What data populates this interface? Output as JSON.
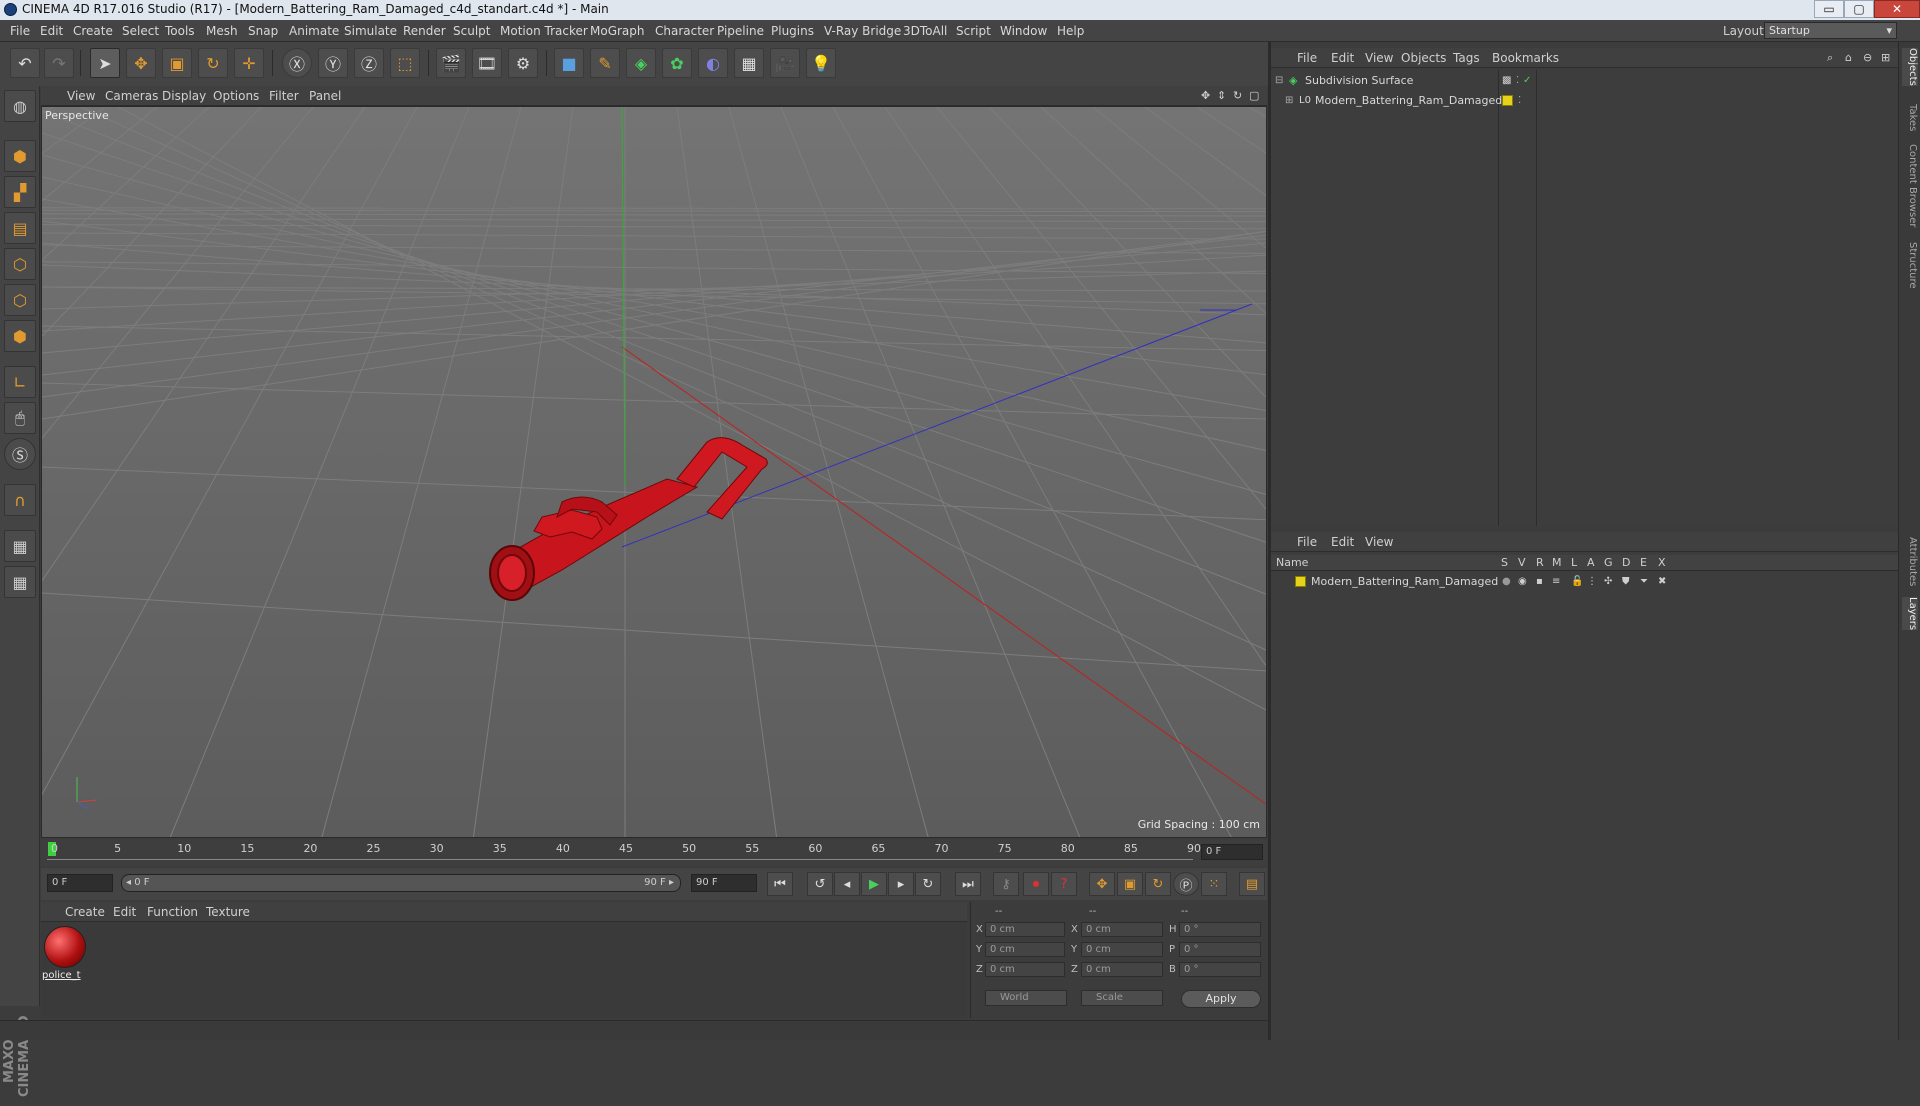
{
  "window": {
    "title": "CINEMA 4D R17.016 Studio (R17) - [Modern_Battering_Ram_Damaged_c4d_standart.c4d *] - Main",
    "minimize": "▭",
    "maximize": "▢",
    "close": "✕"
  },
  "menu": [
    "File",
    "Edit",
    "Create",
    "Select",
    "Tools",
    "Mesh",
    "Snap",
    "Animate",
    "Simulate",
    "Render",
    "Sculpt",
    "Motion Tracker",
    "MoGraph",
    "Character",
    "Pipeline",
    "Plugins",
    "V-Ray Bridge",
    "3DToAll",
    "Script",
    "Window",
    "Help"
  ],
  "layout": {
    "label": "Layout:",
    "value": "Startup"
  },
  "viewport": {
    "menu": [
      "View",
      "Cameras",
      "Display",
      "Options",
      "Filter",
      "Panel"
    ],
    "label": "Perspective",
    "grid_spacing": "Grid Spacing : 100 cm"
  },
  "timeline": {
    "ticks": [
      "0",
      "5",
      "10",
      "15",
      "20",
      "25",
      "30",
      "35",
      "40",
      "45",
      "50",
      "55",
      "60",
      "65",
      "70",
      "75",
      "80",
      "85",
      "90"
    ],
    "current_frame": "0 F",
    "start": "0 F",
    "range_start": "◂ 0 F",
    "range_end": "90 F ▸",
    "end": "90 F"
  },
  "materials": {
    "menu": [
      "Create",
      "Edit",
      "Function",
      "Texture"
    ],
    "items": [
      {
        "name": "police_t"
      }
    ]
  },
  "coordinates": {
    "headers": [
      "--",
      "--",
      "--"
    ],
    "rows": [
      {
        "l1": "X",
        "v1": "0 cm",
        "l2": "X",
        "v2": "0 cm",
        "l3": "H",
        "v3": "0 °"
      },
      {
        "l1": "Y",
        "v1": "0 cm",
        "l2": "Y",
        "v2": "0 cm",
        "l3": "P",
        "v3": "0 °"
      },
      {
        "l1": "Z",
        "v1": "0 cm",
        "l2": "Z",
        "v2": "0 cm",
        "l3": "B",
        "v3": "0 °"
      }
    ],
    "mode": "World",
    "scale": "Scale",
    "apply": "Apply"
  },
  "object_manager": {
    "menu": [
      "File",
      "Edit",
      "View",
      "Objects",
      "Tags",
      "Bookmarks"
    ],
    "objects": [
      {
        "name": "Subdivision Surface"
      },
      {
        "name": "Modern_Battering_Ram_Damaged"
      }
    ]
  },
  "layer_manager": {
    "menu": [
      "File",
      "Edit",
      "View"
    ],
    "columns": [
      "Name",
      "S",
      "V",
      "R",
      "M",
      "L",
      "A",
      "G",
      "D",
      "E",
      "X"
    ],
    "layers": [
      {
        "name": "Modern_Battering_Ram_Damaged",
        "color": "#e6d21a"
      }
    ]
  },
  "side_tabs": [
    "Objects",
    "Takes",
    "Content Browser",
    "Structure",
    "Attributes",
    "Layers"
  ],
  "brand": "MAXON CINEMA 4D",
  "colors": {
    "x_axis": "#d02020",
    "y_axis": "#20b020",
    "z_axis": "#2020d0",
    "model": "#c8141c",
    "accent": "#e09a30"
  }
}
